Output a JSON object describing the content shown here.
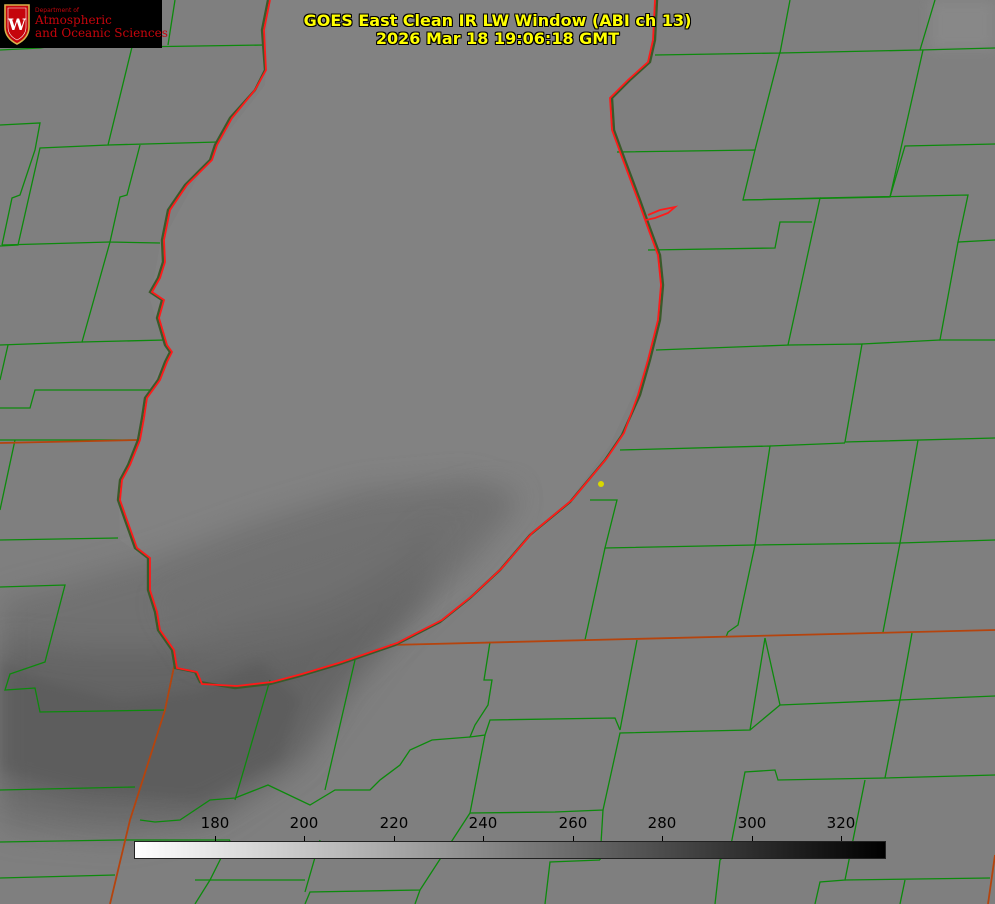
{
  "logo": {
    "department": "Department of",
    "line1": "Atmospheric",
    "line2": "and Oceanic Sciences",
    "crest_letter": "W",
    "colors": {
      "red": "#c5050c",
      "gold": "#d8b24a",
      "background": "#000000"
    }
  },
  "title": {
    "line1": "GOES East Clean IR LW Window (ABI ch 13)",
    "line2": "2026 Mar 18 19:06:18 GMT",
    "color": "#ffff00"
  },
  "colorbar": {
    "ticks": [
      "180",
      "200",
      "220",
      "240",
      "260",
      "280",
      "300",
      "320"
    ],
    "tick_values": [
      180,
      200,
      220,
      240,
      260,
      280,
      300,
      320
    ],
    "range": [
      162,
      330
    ],
    "colormap": "white-to-black"
  },
  "map": {
    "county_line_color": "#0c8a0c",
    "state_line_color": "#b5440e",
    "lake_outline_color": "#ff1a1a",
    "marker_color": "#d8d800"
  }
}
